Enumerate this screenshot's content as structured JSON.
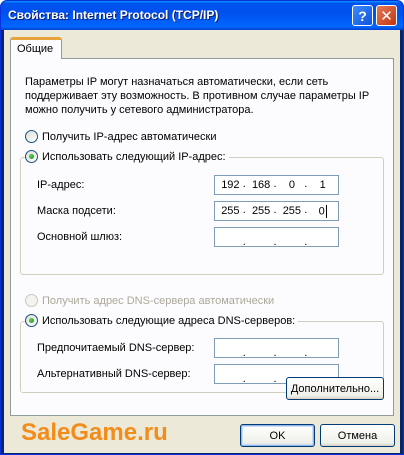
{
  "window": {
    "title": "Свойства: Internet Protocol (TCP/IP)",
    "help_label": "?",
    "close_label": "✕"
  },
  "tabs": [
    {
      "label": "Общие",
      "active": true
    }
  ],
  "intro_text": "Параметры IP могут назначаться автоматически, если сеть поддерживает эту возможность. В противном случае параметры IP можно получить у сетевого администратора.",
  "ip_mode": {
    "auto_label": "Получить IP-адрес автоматически",
    "manual_label": "Использовать следующий IP-адрес:",
    "selected": "manual"
  },
  "ip_fields": {
    "ip_address": {
      "label": "IP-адрес:",
      "octets": [
        "192",
        "168",
        "0",
        "1"
      ]
    },
    "subnet_mask": {
      "label": "Маска подсети:",
      "octets": [
        "255",
        "255",
        "255",
        "0"
      ]
    },
    "gateway": {
      "label": "Основной шлюз:",
      "octets": [
        "",
        "",
        "",
        ""
      ]
    }
  },
  "dns_mode": {
    "auto_label": "Получить адрес DNS-сервера автоматически",
    "manual_label": "Использовать следующие адреса DNS-серверов:",
    "selected": "manual",
    "auto_disabled": true
  },
  "dns_fields": {
    "preferred": {
      "label": "Предпочитаемый DNS-сервер:",
      "octets": [
        "",
        "",
        "",
        ""
      ]
    },
    "alternate": {
      "label": "Альтернативный DNS-сервер:",
      "octets": [
        "",
        "",
        "",
        ""
      ]
    }
  },
  "buttons": {
    "advanced": "Дополнительно...",
    "ok": "OK",
    "cancel": "Отмена"
  },
  "watermark": "SaleGame.ru",
  "colors": {
    "titlebar": "#0054e3",
    "face": "#ece9d8",
    "panel": "#fcfcfe",
    "watermark": "#f28c1a",
    "tab_highlight": "#e6a33c"
  }
}
